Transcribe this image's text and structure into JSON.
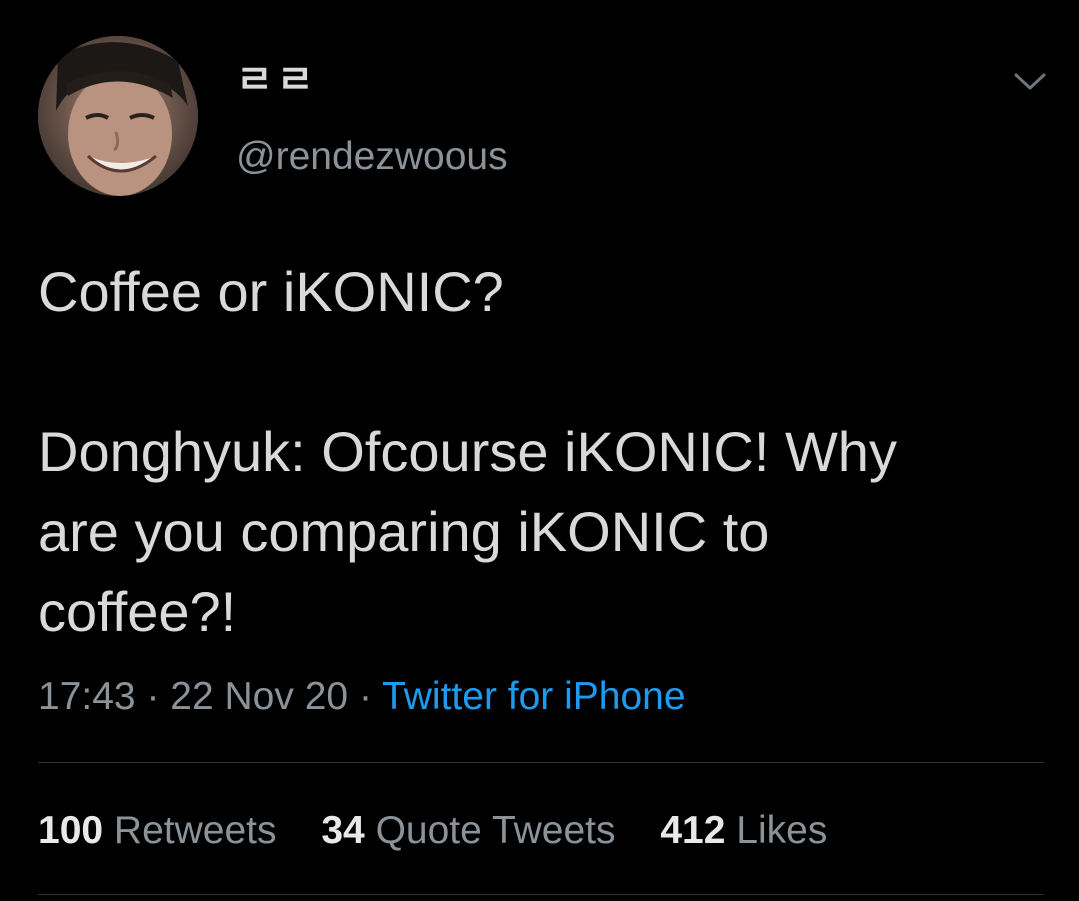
{
  "tweet": {
    "author": {
      "display_name": "ㄹㄹ",
      "handle": "@rendezwoous",
      "avatar_icon": "avatar-photo"
    },
    "menu_icon": "chevron-down-icon",
    "text_lines": [
      "Coffee or iKONIC?",
      "",
      "Donghyuk: Ofcourse iKONIC! Why",
      "are you comparing iKONIC to",
      "coffee?!"
    ],
    "meta": {
      "time": "17:43",
      "separator": "·",
      "date": "22 Nov 20",
      "source": "Twitter for iPhone"
    },
    "stats": {
      "retweets_count": "100",
      "retweets_label": "Retweets",
      "quotes_count": "34",
      "quotes_label": "Quote Tweets",
      "likes_count": "412",
      "likes_label": "Likes"
    }
  },
  "colors": {
    "background": "#000000",
    "text_primary": "#d9d9d9",
    "text_secondary": "#8b9298",
    "link": "#1d9bf0",
    "divider": "#2f3336"
  }
}
